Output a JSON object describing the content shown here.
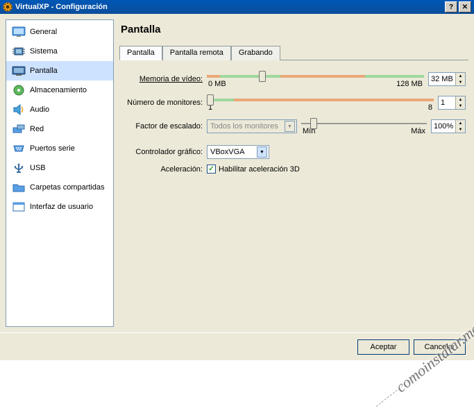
{
  "window": {
    "title": "VirtualXP - Configuración"
  },
  "sidebar": {
    "items": [
      {
        "label": "General",
        "icon": "general"
      },
      {
        "label": "Sistema",
        "icon": "sistema"
      },
      {
        "label": "Pantalla",
        "icon": "pantalla"
      },
      {
        "label": "Almacenamiento",
        "icon": "almacenamiento"
      },
      {
        "label": "Audio",
        "icon": "audio"
      },
      {
        "label": "Red",
        "icon": "red"
      },
      {
        "label": "Puertos serie",
        "icon": "puertos"
      },
      {
        "label": "USB",
        "icon": "usb"
      },
      {
        "label": "Carpetas compartidas",
        "icon": "carpetas"
      },
      {
        "label": "Interfaz de usuario",
        "icon": "interfaz"
      }
    ],
    "selected_index": 2
  },
  "main": {
    "heading": "Pantalla",
    "tabs": [
      {
        "label": "Pantalla"
      },
      {
        "label": "Pantalla remota"
      },
      {
        "label": "Grabando"
      }
    ],
    "active_tab": 0,
    "fields": {
      "video_memory": {
        "label": "Memoria de vídeo:",
        "min_label": "0 MB",
        "max_label": "128 MB",
        "value": "32 MB"
      },
      "monitors": {
        "label": "Número de monitores:",
        "min_label": "1",
        "max_label": "8",
        "value": "1"
      },
      "scale": {
        "label": "Factor de escalado:",
        "dropdown_value": "Todos los monitores",
        "min_label": "Mín",
        "max_label": "Máx",
        "value": "100%"
      },
      "gfx_controller": {
        "label": "Controlador gráfico:",
        "value": "VBoxVGA"
      },
      "accel": {
        "label": "Aceleración:",
        "checkbox_label": "Habilitar aceleración 3D",
        "checked": true
      }
    }
  },
  "footer": {
    "ok": "Aceptar",
    "cancel": "Cancelar"
  },
  "watermark": "comoinstalar.me"
}
